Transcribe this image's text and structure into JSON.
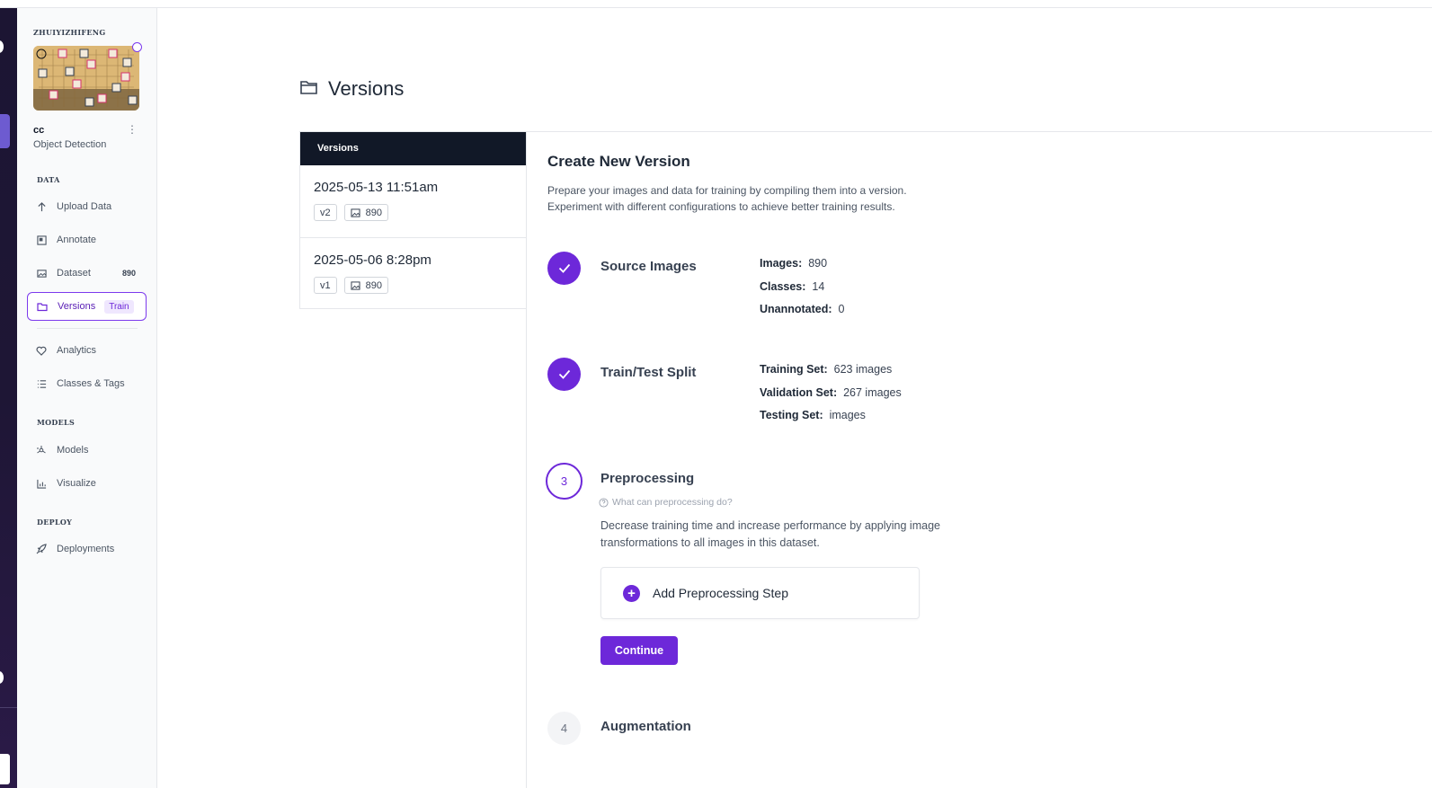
{
  "workspace": {
    "name": "ZHUIYIZHIFENG"
  },
  "project": {
    "name": "cc",
    "type": "Object Detection"
  },
  "sidebar": {
    "sections": {
      "data": "DATA",
      "models": "MODELS",
      "deploy": "DEPLOY"
    },
    "items": [
      {
        "label": "Upload Data",
        "icon": "upload-icon"
      },
      {
        "label": "Annotate",
        "icon": "annotate-icon"
      },
      {
        "label": "Dataset",
        "icon": "image-icon",
        "count": "890"
      },
      {
        "label": "Versions",
        "icon": "folder-icon",
        "tag": "Train"
      },
      {
        "label": "Analytics",
        "icon": "heart-icon"
      },
      {
        "label": "Classes & Tags",
        "icon": "list-icon"
      },
      {
        "label": "Models",
        "icon": "models-icon"
      },
      {
        "label": "Visualize",
        "icon": "chart-icon"
      },
      {
        "label": "Deployments",
        "icon": "rocket-icon"
      }
    ]
  },
  "page": {
    "title": "Versions"
  },
  "versions_panel": {
    "header": "Versions",
    "items": [
      {
        "date": "2025-05-13 11:51am",
        "version": "v2",
        "images": "890"
      },
      {
        "date": "2025-05-06 8:28pm",
        "version": "v1",
        "images": "890"
      }
    ]
  },
  "create": {
    "title": "Create New Version",
    "desc_line1": "Prepare your images and data for training by compiling them into a version.",
    "desc_line2": "Experiment with different configurations to achieve better training results.",
    "steps": {
      "source": {
        "title": "Source Images",
        "images_label": "Images:",
        "images_value": "890",
        "classes_label": "Classes:",
        "classes_value": "14",
        "unannotated_label": "Unannotated:",
        "unannotated_value": "0"
      },
      "split": {
        "title": "Train/Test Split",
        "training_label": "Training Set:",
        "training_value": "623 images",
        "validation_label": "Validation Set:",
        "validation_value": "267 images",
        "testing_label": "Testing Set:",
        "testing_value": "images"
      },
      "preprocessing": {
        "number": "3",
        "title": "Preprocessing",
        "help": "What can preprocessing do?",
        "desc_line1": "Decrease training time and increase performance by applying image",
        "desc_line2": "transformations to all images in this dataset.",
        "add_label": "Add Preprocessing Step",
        "continue_label": "Continue"
      },
      "augmentation": {
        "number": "4",
        "title": "Augmentation"
      }
    }
  },
  "colors": {
    "accent": "#6d28d9",
    "rail": "#1c1533",
    "header": "#111827"
  }
}
